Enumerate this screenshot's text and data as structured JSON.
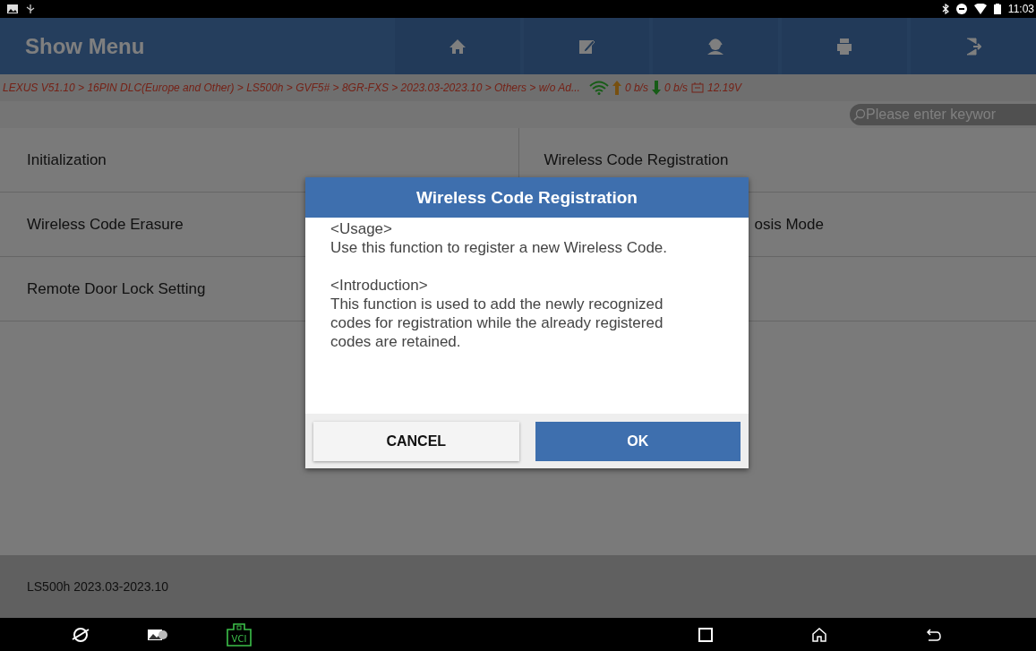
{
  "status_bar": {
    "time": "11:03"
  },
  "header": {
    "title": "Show Menu",
    "tools": [
      {
        "kind": "home"
      },
      {
        "kind": "edit"
      },
      {
        "kind": "user"
      },
      {
        "kind": "print"
      },
      {
        "kind": "exit"
      }
    ]
  },
  "breadcrumb": {
    "path": "LEXUS V51.10 > 16PIN DLC(Europe and Other) > LS500h > GVF5# > 8GR-FXS > 2023.03-2023.10 > Others > w/o Ad...",
    "upload": "0 b/s",
    "download": "0 b/s",
    "voltage": "12.19V"
  },
  "search": {
    "placeholder": "Please enter keywor"
  },
  "menu_items": [
    {
      "label": "Initialization",
      "partly_hidden": false
    },
    {
      "label": "Wireless Code Registration",
      "partly_hidden": false
    },
    {
      "label": "Wireless Code Erasure",
      "partly_hidden": false
    },
    {
      "label": "osis Mode",
      "partly_hidden": true
    },
    {
      "label": "Remote Door Lock Setting",
      "partly_hidden": false
    }
  ],
  "footer": {
    "text": "LS500h 2023.03-2023.10"
  },
  "dialog": {
    "title": "Wireless Code Registration",
    "paragraphs": [
      [
        "<Usage>",
        "Use this function to register a new Wireless Code."
      ],
      [
        "<Introduction>",
        "This function is used to add the newly recognized codes for registration while the already registered codes are retained."
      ]
    ],
    "buttons": [
      {
        "label": "CANCEL",
        "kind": "secondary"
      },
      {
        "label": "OK",
        "kind": "primary"
      }
    ]
  },
  "nav_bar": {
    "vci_label": "VCI"
  }
}
